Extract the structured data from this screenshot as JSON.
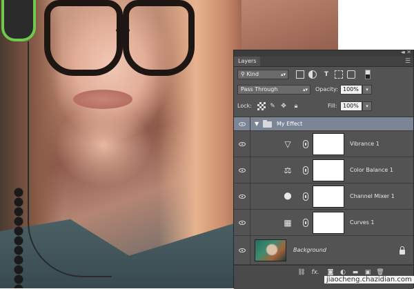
{
  "panel": {
    "title": "Layers",
    "collapse_glyph": "◂◂",
    "close_glyph": "✕",
    "menu_glyph": "☰"
  },
  "filter": {
    "kind_label": "Kind",
    "search_glyph": "⚲"
  },
  "blend": {
    "mode": "Pass Through",
    "opacity_label": "Opacity:",
    "opacity_value": "100%",
    "lock_label": "Lock:",
    "fill_label": "Fill:",
    "fill_value": "100%"
  },
  "layers": [
    {
      "name": "My Effect",
      "type": "group",
      "expanded": true,
      "selected": true
    },
    {
      "name": "Vibrance 1",
      "type": "adjustment",
      "icon": "vibrance-icon",
      "glyph": "▽"
    },
    {
      "name": "Color Balance 1",
      "type": "adjustment",
      "icon": "color-balance-icon",
      "glyph": "⚖"
    },
    {
      "name": "Channel Mixer 1",
      "type": "adjustment",
      "icon": "channel-mixer-icon",
      "glyph": "⬤"
    },
    {
      "name": "Curves 1",
      "type": "adjustment",
      "icon": "curves-icon",
      "glyph": "▦"
    },
    {
      "name": "Background",
      "type": "image",
      "locked": true
    }
  ],
  "bottom_bar": {
    "fx_label": "fx."
  },
  "watermark": "jiaocheng.chazidian.com",
  "colors": {
    "panel_bg": "#535353",
    "selected_row": "#7b8595",
    "field_bg": "#f2f2f2"
  }
}
